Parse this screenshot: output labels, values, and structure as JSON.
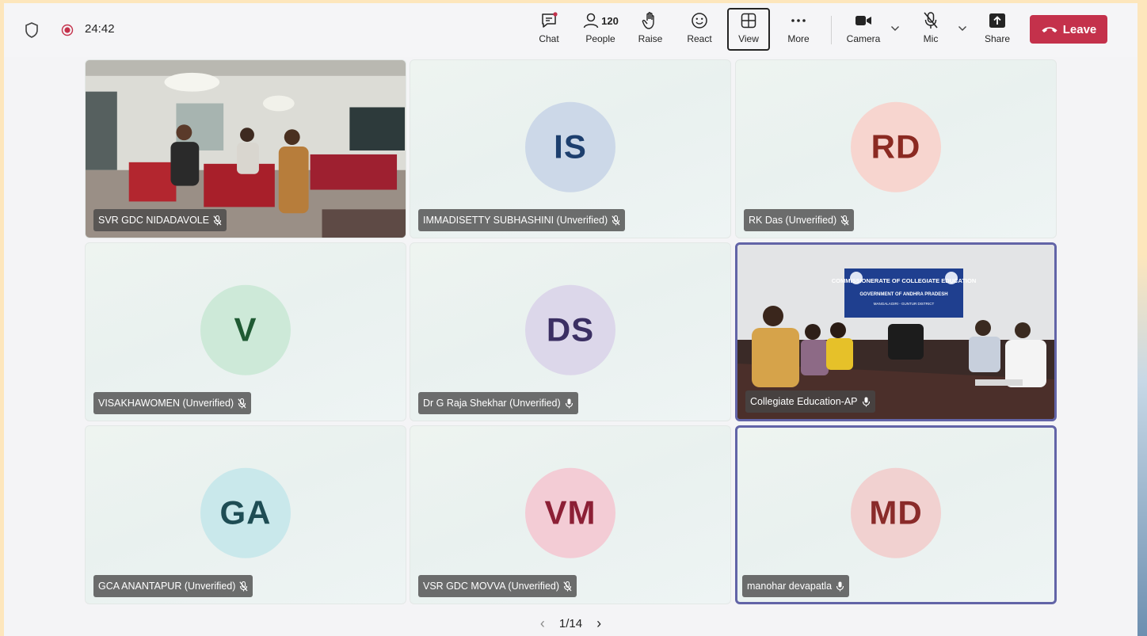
{
  "call": {
    "timer": "24:42",
    "people_count": "120"
  },
  "toolbar": [
    {
      "id": "chat",
      "label": "Chat"
    },
    {
      "id": "people",
      "label": "People"
    },
    {
      "id": "raise",
      "label": "Raise"
    },
    {
      "id": "react",
      "label": "React"
    },
    {
      "id": "view",
      "label": "View"
    },
    {
      "id": "more",
      "label": "More"
    },
    {
      "id": "camera",
      "label": "Camera"
    },
    {
      "id": "mic",
      "label": "Mic"
    },
    {
      "id": "share",
      "label": "Share"
    }
  ],
  "leave_label": "Leave",
  "participants": [
    {
      "name": "SVR GDC NIDADAVOLE",
      "type": "video",
      "mic": "muted"
    },
    {
      "name": "IMMADISETTY SUBHASHINI (Unverified)",
      "initials": "IS",
      "avatar_bg": "#ccd8e8",
      "avatar_fg": "#1d3f6e",
      "mic": "muted"
    },
    {
      "name": "RK Das (Unverified)",
      "initials": "RD",
      "avatar_bg": "#f7d5cf",
      "avatar_fg": "#8b2a22",
      "mic": "muted"
    },
    {
      "name": "VISAKHAWOMEN (Unverified)",
      "initials": "V",
      "avatar_bg": "#cde9d8",
      "avatar_fg": "#1f5a33",
      "mic": "muted"
    },
    {
      "name": "Dr G Raja Shekhar (Unverified)",
      "initials": "DS",
      "avatar_bg": "#dcd7ea",
      "avatar_fg": "#3b2f63",
      "mic": "on"
    },
    {
      "name": "Collegiate Education-AP",
      "type": "video",
      "mic": "on",
      "speaking": true
    },
    {
      "name": "GCA ANANTAPUR (Unverified)",
      "initials": "GA",
      "avatar_bg": "#c9e8eb",
      "avatar_fg": "#1e4d54",
      "mic": "muted"
    },
    {
      "name": "VSR GDC MOVVA (Unverified)",
      "initials": "VM",
      "avatar_bg": "#f3ccd5",
      "avatar_fg": "#8c1f35",
      "mic": "muted"
    },
    {
      "name": "manohar devapatla",
      "initials": "MD",
      "avatar_bg": "#f1d1d0",
      "avatar_fg": "#8a2b2a",
      "mic": "on",
      "speaking": true
    }
  ],
  "banner": {
    "line1": "COMMISSIONERATE OF COLLEGIATE EDUCATION",
    "line2": "GOVERNMENT OF ANDHRA PRADESH",
    "line3": "MANGALAGIRI - GUNTUR DISTRICT"
  },
  "pager": {
    "label": "1/14"
  },
  "icons": {
    "security": "shield-icon",
    "recording": "record-icon",
    "chat": "chat-icon",
    "people": "people-icon",
    "raise": "hand-icon",
    "react": "smiley-icon",
    "view": "grid-icon",
    "more": "ellipsis-icon",
    "camera": "camera-icon",
    "mic": "mic-off-icon",
    "share": "share-icon",
    "leave": "phone-hangup-icon"
  },
  "colors": {
    "leave": "#c4314b",
    "speaking": "#6264a7",
    "record": "#c4314b"
  }
}
